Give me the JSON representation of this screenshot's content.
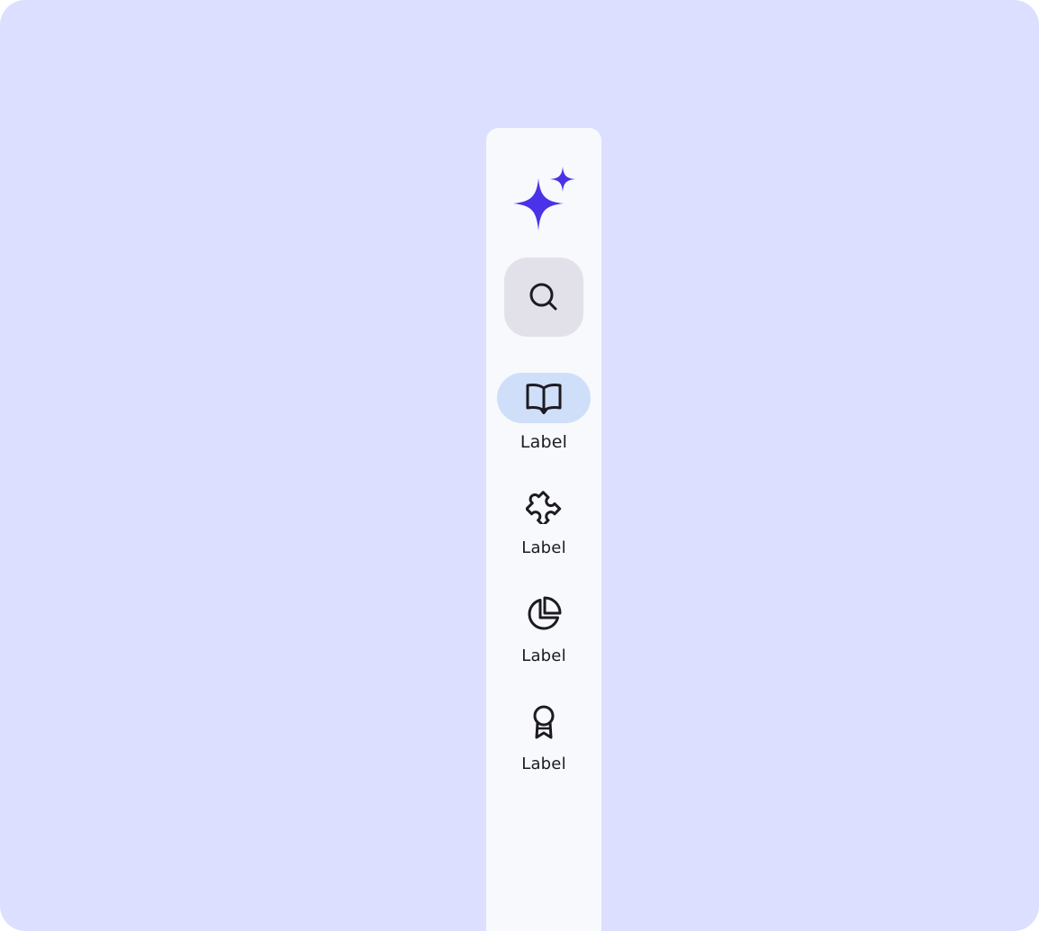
{
  "colors": {
    "background": "#dcdfff",
    "rail": "#f7f9fc",
    "accent": "#4a32e8",
    "fab": "#e2e1ea",
    "active_indicator": "#cfdff9",
    "icon": "#1d1b20"
  },
  "logo": {
    "icon": "sparkle-icon"
  },
  "fab": {
    "icon": "search-icon"
  },
  "nav": {
    "items": [
      {
        "label": "Label",
        "icon": "book-open-icon",
        "active": true
      },
      {
        "label": "Label",
        "icon": "puzzle-icon",
        "active": false
      },
      {
        "label": "Label",
        "icon": "pie-chart-icon",
        "active": false
      },
      {
        "label": "Label",
        "icon": "award-ribbon-icon",
        "active": false
      }
    ]
  }
}
